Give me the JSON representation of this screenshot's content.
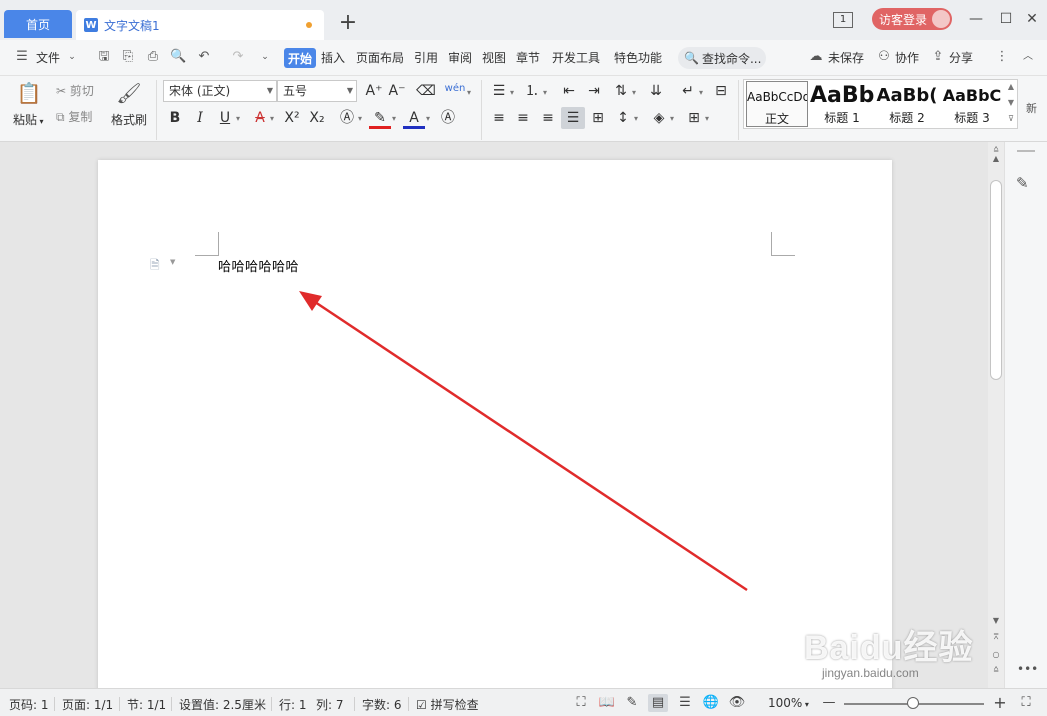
{
  "titlebar": {
    "home_tab": "首页",
    "doc_tab": "文字文稿1",
    "doc_icon": "W",
    "window_count": "1",
    "login": "访客登录"
  },
  "menu": {
    "file": "文件",
    "items": [
      "开始",
      "插入",
      "页面布局",
      "引用",
      "审阅",
      "视图",
      "章节",
      "开发工具",
      "特色功能"
    ],
    "search": "查找命令...",
    "unsaved": "未保存",
    "collab": "协作",
    "share": "分享"
  },
  "ribbon": {
    "paste": "粘贴",
    "cut": "剪切",
    "copy": "复制",
    "format_painter": "格式刷",
    "font_name": "宋体 (正文)",
    "font_size": "五号",
    "phonetic": "wén",
    "styles": [
      {
        "sample": "AaBbCcDd",
        "name": "正文"
      },
      {
        "sample": "AaBb",
        "name": "标题 1"
      },
      {
        "sample": "AaBb(",
        "name": "标题 2"
      },
      {
        "sample": "AaBbC",
        "name": "标题 3"
      }
    ],
    "new_style_partial": "新"
  },
  "document": {
    "text": "哈哈哈哈哈哈"
  },
  "status": {
    "page_num": "页码: 1",
    "page_count": "页面: 1/1",
    "section": "节: 1/1",
    "setting": "设置值: 2.5厘米",
    "row": "行: 1",
    "col": "列: 7",
    "word_count": "字数: 6",
    "spellcheck": "拼写检查",
    "zoom": "100%"
  },
  "watermark": {
    "brand": "Baidu经验",
    "url": "jingyan.baidu.com"
  },
  "colors": {
    "accent": "#4a86e8",
    "login": "#e06464",
    "arrow": "#e02b2b"
  }
}
